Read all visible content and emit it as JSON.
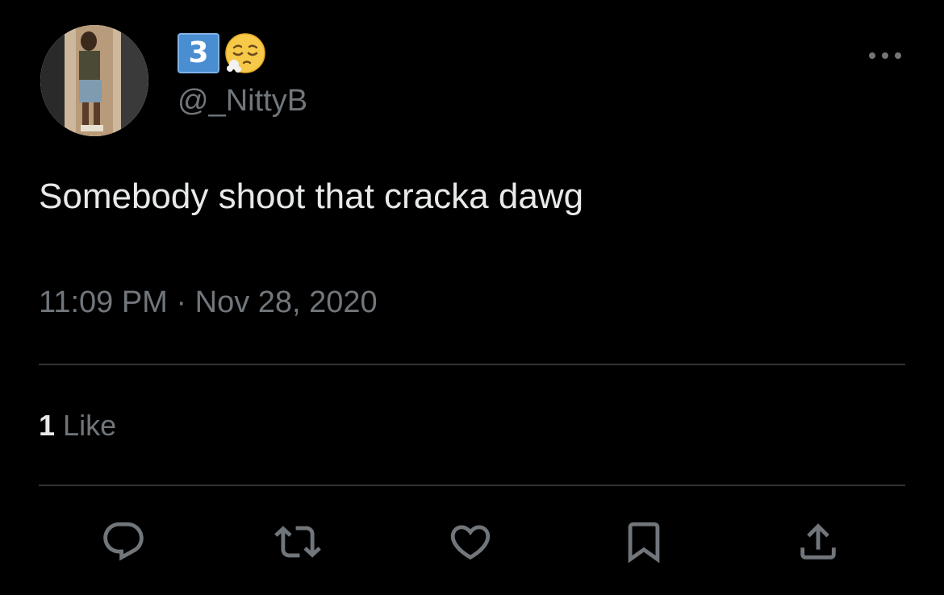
{
  "tweet": {
    "display_name_keycap": "3",
    "display_name_emoji": "relieved-face-emoji",
    "handle": "@_NittyB",
    "text": "Somebody shoot that cracka dawg",
    "time": "11:09 PM",
    "separator": "·",
    "date": "Nov 28, 2020",
    "likes": {
      "count": "1",
      "label": "Like"
    }
  },
  "actions": [
    {
      "icon": "reply-icon"
    },
    {
      "icon": "retweet-icon"
    },
    {
      "icon": "like-heart-icon"
    },
    {
      "icon": "bookmark-icon"
    },
    {
      "icon": "share-icon"
    }
  ],
  "colors": {
    "background": "#000000",
    "primary_text": "#e7e9ea",
    "secondary_text": "#71767b",
    "divider": "#2f3336",
    "keycap": "#4a8ed2"
  }
}
